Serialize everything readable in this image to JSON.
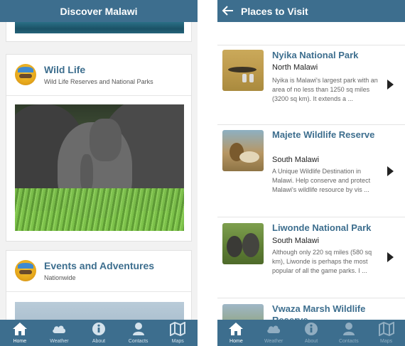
{
  "left_screen": {
    "header_title": "Discover Malawi",
    "cards": [
      {
        "title": "Wild Life",
        "subtitle": "Wild Life Reserves and National Parks"
      },
      {
        "title": "Events and Adventures",
        "subtitle": "Nationwide"
      }
    ],
    "tabs": [
      {
        "label": "Home",
        "icon": "home-icon",
        "active": true
      },
      {
        "label": "Weather",
        "icon": "cloud-icon",
        "active": false
      },
      {
        "label": "About",
        "icon": "info-icon",
        "active": false
      },
      {
        "label": "Contacts",
        "icon": "person-icon",
        "active": false
      },
      {
        "label": "Maps",
        "icon": "map-icon",
        "active": false
      }
    ]
  },
  "right_screen": {
    "header_title": "Places to Visit",
    "places": [
      {
        "name": "Nyika National Park",
        "region": "North Malawi",
        "description": "Nyika is Malawi's largest park with an area of no less than 1250 sq miles (3200 sq km). It extends a ..."
      },
      {
        "name": "Majete Wildlife Reserve",
        "region": "South Malawi",
        "description": "A Unique Wildlife Destination in Malawi. Help conserve and protect Malawi's wildlife resource by vis ..."
      },
      {
        "name": "Liwonde National Park",
        "region": "South Malawi",
        "description": "Although only 220 sq miles (580 sq km), Liwonde is perhaps the most popular of all the game parks. I ..."
      },
      {
        "name": "Vwaza Marsh Wildlife Reserve",
        "region": "",
        "description": ""
      }
    ],
    "tabs": [
      {
        "label": "Home",
        "icon": "home-icon",
        "active": true
      },
      {
        "label": "Weather",
        "icon": "cloud-icon",
        "active": false
      },
      {
        "label": "About",
        "icon": "info-icon",
        "active": false
      },
      {
        "label": "Contacts",
        "icon": "person-icon",
        "active": false
      },
      {
        "label": "Maps",
        "icon": "map-icon",
        "active": false
      }
    ]
  },
  "colors": {
    "brand": "#3d6e8e",
    "title_text": "#3d6e8e",
    "background": "#f2f2f2"
  }
}
